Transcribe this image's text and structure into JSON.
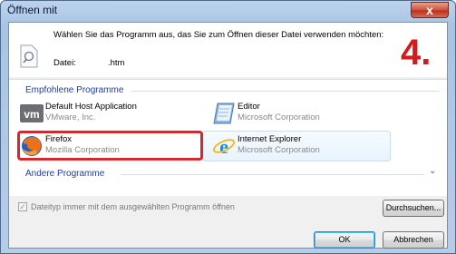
{
  "window": {
    "title": "Öffnen mit",
    "close_symbol": "x"
  },
  "header": {
    "prompt": "Wählen Sie das Programm aus, das Sie zum Öffnen dieser Datei verwenden möchten:",
    "file_label": "Datei:",
    "file_value": ".htm",
    "step_marker": "4."
  },
  "recommended": {
    "title": "Empfohlene Programme",
    "programs": [
      {
        "name": "Default Host Application",
        "company": "VMware, Inc.",
        "icon": "vmware-icon"
      },
      {
        "name": "Editor",
        "company": "Microsoft Corporation",
        "icon": "notepad-icon"
      },
      {
        "name": "Firefox",
        "company": "Mozilla Corporation",
        "icon": "firefox-icon",
        "selected": true
      },
      {
        "name": "Internet Explorer",
        "company": "Microsoft Corporation",
        "icon": "ie-icon"
      }
    ]
  },
  "other": {
    "title": "Andere Programme",
    "expand_symbol": "⌄"
  },
  "footer": {
    "checkbox_label": "Dateityp immer mit dem ausgewählten Programm öffnen",
    "checkbox_checked": true,
    "checkbox_mark": "✓",
    "browse_label": "Durchsuchen...",
    "ok_label": "OK",
    "cancel_label": "Abbrechen"
  },
  "colors": {
    "accent_blue": "#1e3da0",
    "highlight_red": "#d9262b",
    "step_red": "#d51b1b"
  }
}
